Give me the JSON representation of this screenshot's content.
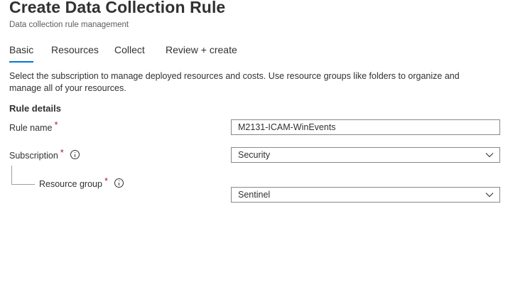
{
  "header": {
    "title": "Create Data Collection Rule",
    "subtitle": "Data collection rule management"
  },
  "tabs": [
    {
      "label": "Basic",
      "active": true
    },
    {
      "label": "Resources",
      "active": false
    },
    {
      "label": "Collect",
      "active": false
    },
    {
      "label": "Review + create",
      "active": false
    }
  ],
  "description": "Select the subscription to manage deployed resources and costs. Use resource groups like folders to organize and manage all of your resources.",
  "rule_details": {
    "section_title": "Rule details",
    "rule_name": {
      "label": "Rule name",
      "required_marker": "*",
      "value": "M2131-ICAM-WinEvents"
    },
    "subscription": {
      "label": "Subscription",
      "required_marker": "*",
      "info_icon": "info-icon",
      "value": "Security"
    },
    "resource_group": {
      "label": "Resource group",
      "required_marker": "*",
      "info_icon": "info-icon",
      "value": "Sentinel"
    }
  },
  "colors": {
    "accent": "#0078d4",
    "required": "#a4262c",
    "border": "#8a8886",
    "text": "#323130"
  }
}
